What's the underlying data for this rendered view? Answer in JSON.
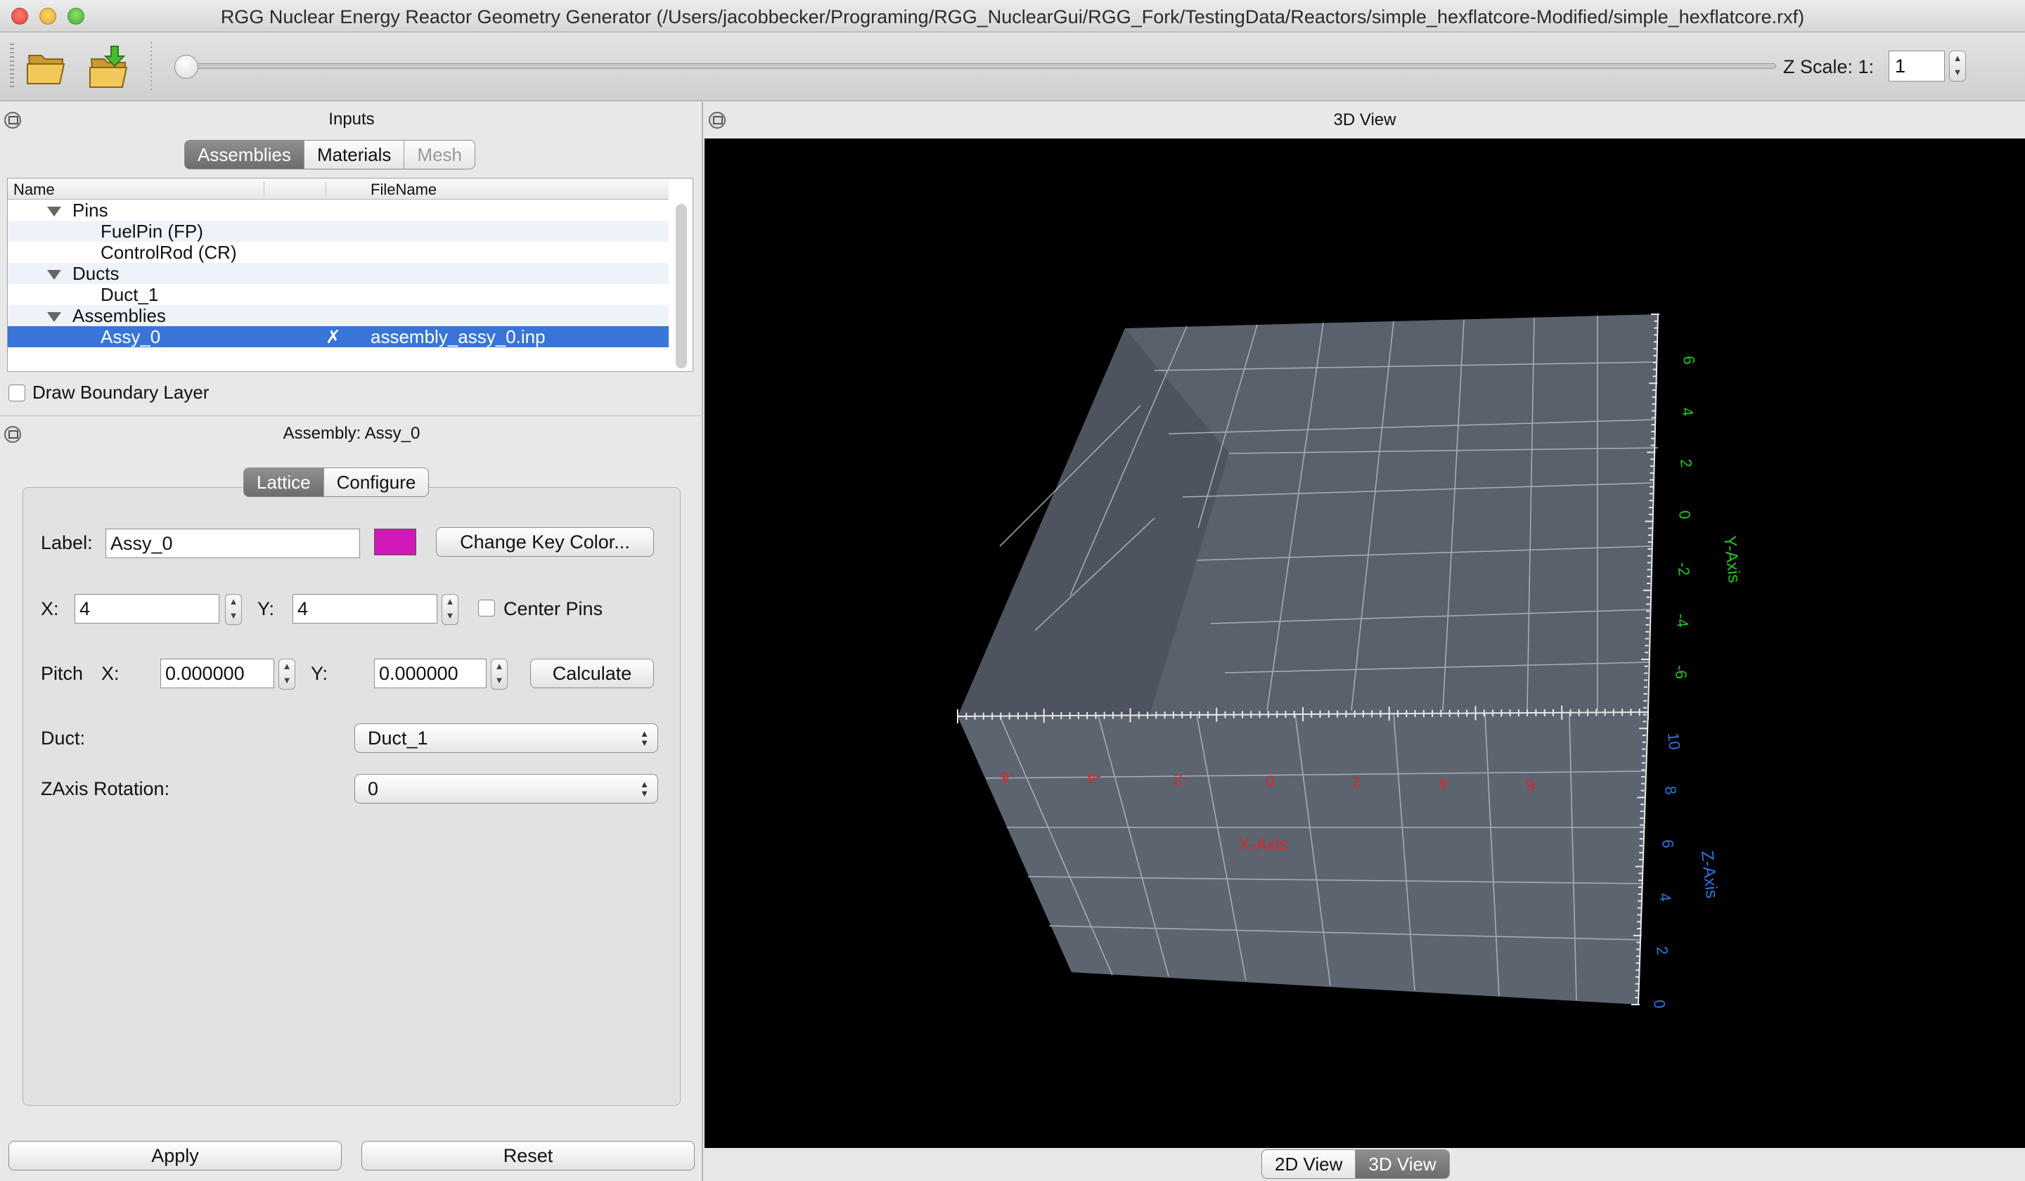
{
  "window": {
    "title": "RGG Nuclear Energy Reactor Geometry Generator (/Users/jacobbecker/Programing/RGG_NuclearGui/RGG_Fork/TestingData/Reactors/simple_hexflatcore-Modified/simple_hexflatcore.rxf)"
  },
  "toolbar": {
    "zscale_label": "Z Scale: 1:",
    "zscale_value": "1",
    "slider_value": 0
  },
  "inputs": {
    "title": "Inputs",
    "tabs": [
      "Assemblies",
      "Materials",
      "Mesh"
    ],
    "active_tab": "Assemblies",
    "columns": [
      "Name",
      "FileName"
    ],
    "tree": [
      {
        "label": "Pins",
        "expanded": true
      },
      {
        "label": "FuelPin (FP)"
      },
      {
        "label": "ControlRod (CR)"
      },
      {
        "label": "Ducts",
        "expanded": true
      },
      {
        "label": "Duct_1"
      },
      {
        "label": "Assemblies",
        "expanded": true
      },
      {
        "label": "Assy_0",
        "mark": "✗",
        "filename": "assembly_assy_0.inp",
        "selected": true
      }
    ],
    "boundary_label": "Draw Boundary Layer"
  },
  "assembly": {
    "title": "Assembly: Assy_0",
    "tabs": [
      "Lattice",
      "Configure"
    ],
    "active_tab": "Lattice",
    "label_caption": "Label:",
    "label_value": "Assy_0",
    "key_color": "#d118b8",
    "change_color_label": "Change Key Color...",
    "x_caption": "X:",
    "x_value": "4",
    "y_caption": "Y:",
    "y_value": "4",
    "center_pins_label": "Center Pins",
    "pitch_caption": "Pitch",
    "pitch_x_caption": "X:",
    "pitch_x_value": "0.000000",
    "pitch_y_caption": "Y:",
    "pitch_y_value": "0.000000",
    "calculate_label": "Calculate",
    "duct_caption": "Duct:",
    "duct_value": "Duct_1",
    "zrot_caption": "ZAxis Rotation:",
    "zrot_value": "0",
    "apply_label": "Apply",
    "reset_label": "Reset"
  },
  "view": {
    "title": "3D View",
    "tabs": [
      "2D View",
      "3D View"
    ],
    "active_tab": "3D View",
    "axes": {
      "x_label": "X-Axis",
      "y_label": "Y-Axis",
      "z_label": "Z-Axis",
      "x_ticks": [
        "-6",
        "-4",
        "-2",
        "0",
        "2",
        "4",
        "6"
      ],
      "y_ticks": [
        "6",
        "4",
        "2",
        "0",
        "-2",
        "-4",
        "-6"
      ],
      "z_ticks": [
        "10",
        "8",
        "6",
        "4",
        "2",
        "0"
      ],
      "x_color": "#e0252a",
      "y_color": "#23c423",
      "z_color": "#2a76e0"
    }
  }
}
